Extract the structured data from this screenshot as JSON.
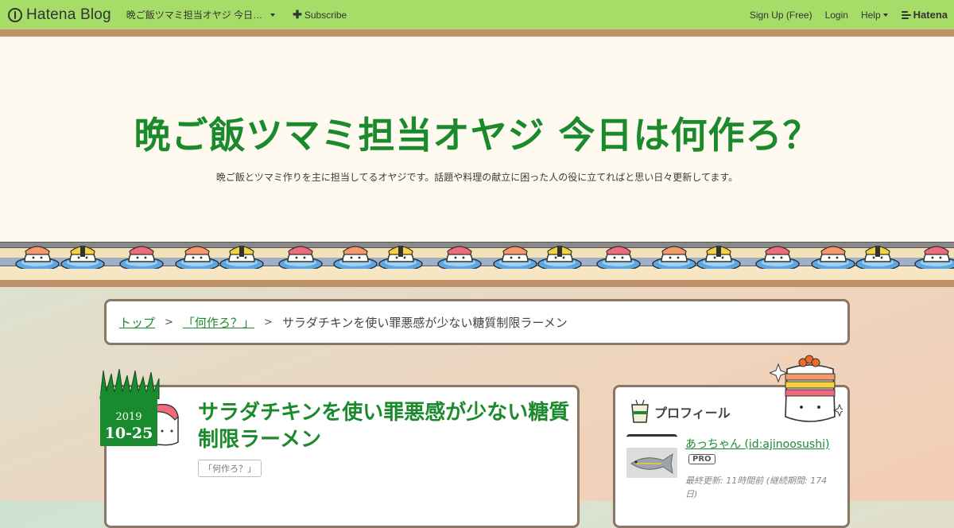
{
  "topbar": {
    "brand": "Hatena Blog",
    "blog_name": "晩ご飯ツマミ担当オヤジ 今日…",
    "subscribe": "Subscribe",
    "signup": "Sign Up (Free)",
    "login": "Login",
    "help": "Help",
    "hatena": "Hatena",
    "bar_color": "#a6dd68"
  },
  "header": {
    "title": "晩ご飯ツマミ担当オヤジ 今日は何作ろ？",
    "description": "晩ご飯とツマミ作りを主に担当してるオヤジです。話題や料理の献立に困った人の役に立てればと思い日々更新してます。",
    "title_color": "#1b8a2c"
  },
  "breadcrumb": {
    "top": "トップ",
    "separator": ">",
    "category": "「何作ろ？」",
    "current": "サラダチキンを使い罪悪感が少ない糖質制限ラーメン"
  },
  "article": {
    "date_year": "2019",
    "date_md": "10-25",
    "title": "サラダチキンを使い罪悪感が少ない糖質制限ラーメン",
    "category": "「何作ろ？」"
  },
  "sidebar": {
    "profile_heading": "プロフィール",
    "name": "あっちゃん (id:ajinoosushi)",
    "badge": "PRO",
    "meta": "最終更新: 11時間前 (継続期間: 174日)"
  }
}
